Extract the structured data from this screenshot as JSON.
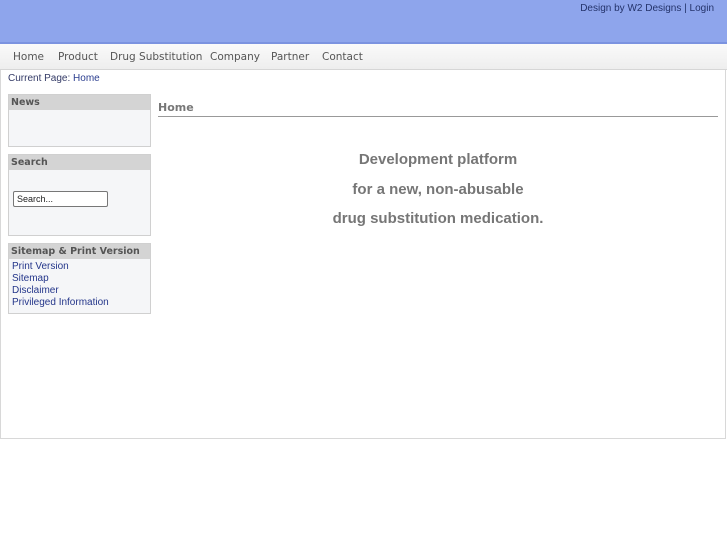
{
  "header": {
    "credit_text": "Design by W2 Designs",
    "separator": "|",
    "login_label": "Login"
  },
  "nav": {
    "items": [
      "Home",
      "Product",
      "Drug Substitution",
      "Company",
      "Partner",
      "Contact"
    ]
  },
  "breadcrumb": {
    "prefix": "Current Page:",
    "current": "Home"
  },
  "sidebar": {
    "news": {
      "title": "News"
    },
    "search": {
      "title": "Search",
      "placeholder": "Search..."
    },
    "sitemap": {
      "title": "Sitemap & Print Version",
      "links": [
        "Print Version",
        "Sitemap",
        "Disclaimer",
        "Privileged Information"
      ]
    }
  },
  "main": {
    "heading": "Home",
    "tagline": [
      "Development platform",
      "for a new, non-abusable",
      "drug substitution medication."
    ]
  },
  "colors": {
    "header_bg": "#8ea5ec",
    "link": "#24368a",
    "text_gray": "#767676"
  }
}
